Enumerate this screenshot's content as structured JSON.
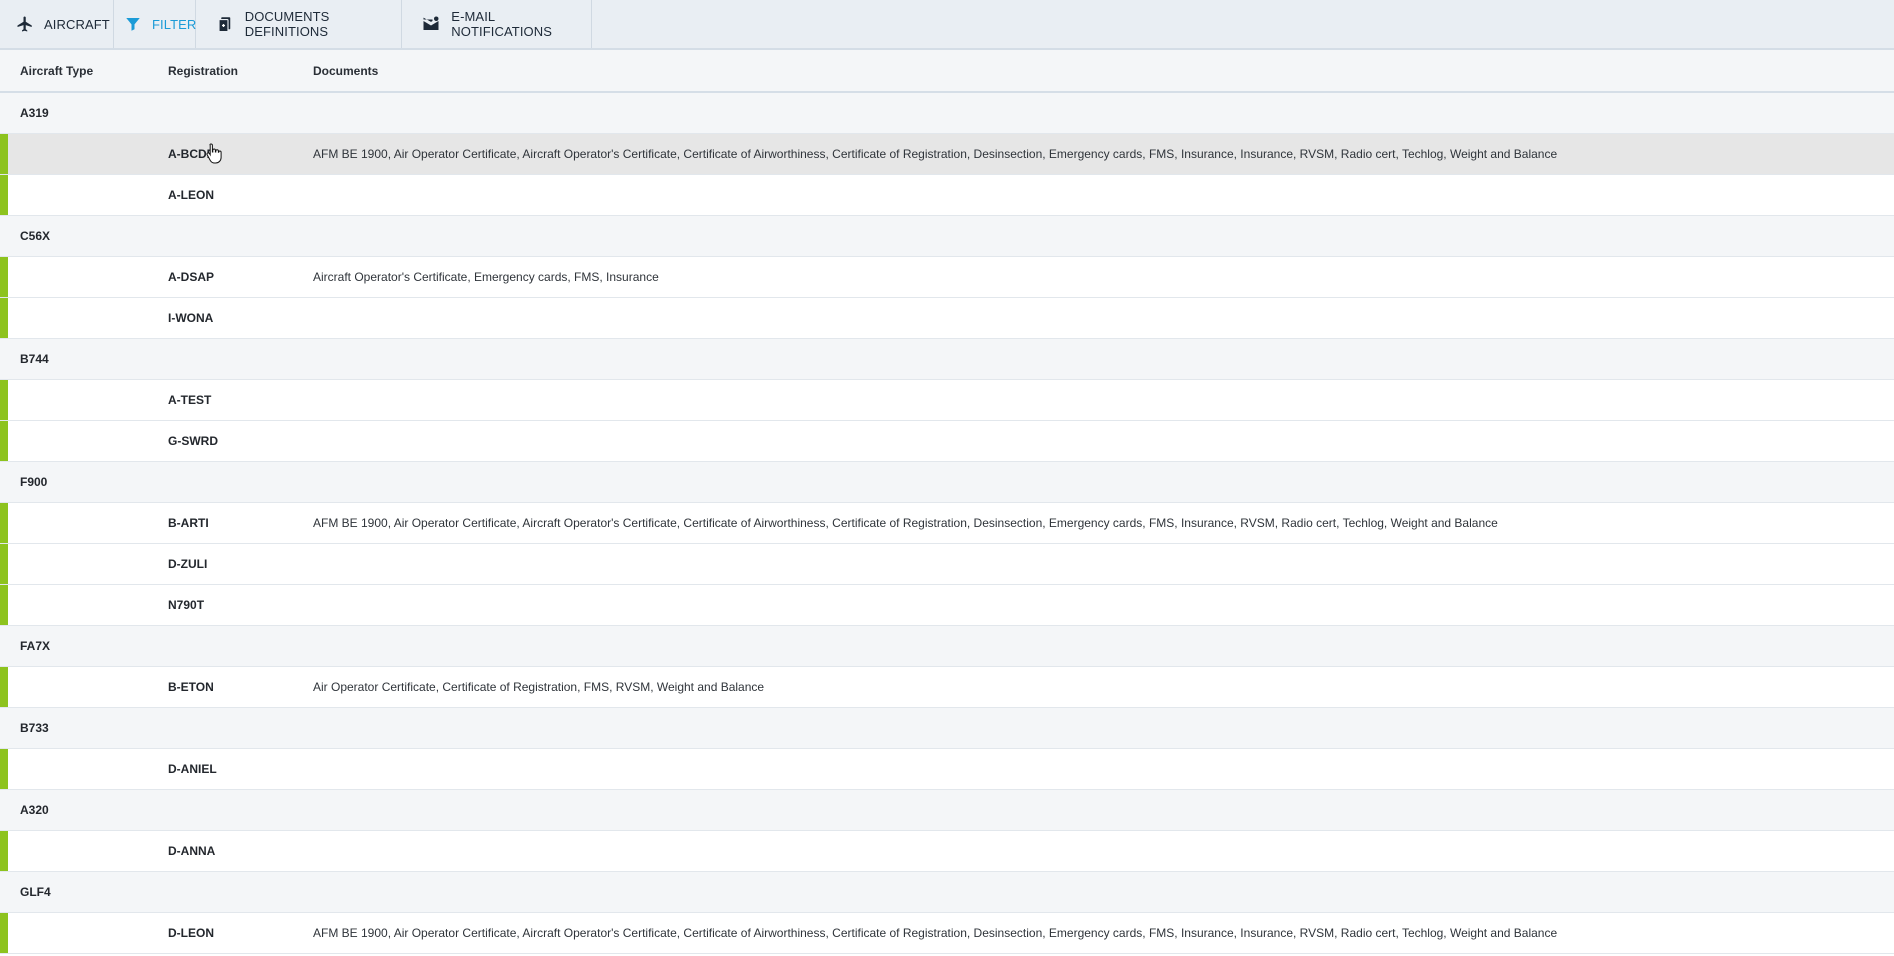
{
  "toolbar": {
    "aircraft_label": "AIRCRAFT",
    "filter_label": "FILTER",
    "documents_definitions_label": "DOCUMENTS DEFINITIONS",
    "email_notifications_label": "E-MAIL NOTIFICATIONS",
    "active_color": "#1b9bd7"
  },
  "table": {
    "headers": {
      "aircraft_type": "Aircraft Type",
      "registration": "Registration",
      "documents": "Documents"
    },
    "status_color": "#8dc31e",
    "groups": [
      {
        "type": "A319",
        "rows": [
          {
            "registration": "A-BCDE",
            "documents": "AFM BE 1900, Air Operator Certificate, Aircraft Operator's Certificate, Certificate of Airworthiness, Certificate of Registration, Desinsection, Emergency cards, FMS, Insurance, Insurance, RVSM, Radio cert, Techlog, Weight and Balance"
          },
          {
            "registration": "A-LEON",
            "documents": ""
          }
        ]
      },
      {
        "type": "C56X",
        "rows": [
          {
            "registration": "A-DSAP",
            "documents": "Aircraft Operator's Certificate, Emergency cards, FMS, Insurance"
          },
          {
            "registration": "I-WONA",
            "documents": ""
          }
        ]
      },
      {
        "type": "B744",
        "rows": [
          {
            "registration": "A-TEST",
            "documents": ""
          },
          {
            "registration": "G-SWRD",
            "documents": ""
          }
        ]
      },
      {
        "type": "F900",
        "rows": [
          {
            "registration": "B-ARTI",
            "documents": "AFM BE 1900, Air Operator Certificate, Aircraft Operator's Certificate, Certificate of Airworthiness, Certificate of Registration, Desinsection, Emergency cards, FMS, Insurance, RVSM, Radio cert, Techlog, Weight and Balance"
          },
          {
            "registration": "D-ZULI",
            "documents": ""
          },
          {
            "registration": "N790T",
            "documents": ""
          }
        ]
      },
      {
        "type": "FA7X",
        "rows": [
          {
            "registration": "B-ETON",
            "documents": "Air Operator Certificate, Certificate of Registration, FMS, RVSM, Weight and Balance"
          }
        ]
      },
      {
        "type": "B733",
        "rows": [
          {
            "registration": "D-ANIEL",
            "documents": ""
          }
        ]
      },
      {
        "type": "A320",
        "rows": [
          {
            "registration": "D-ANNA",
            "documents": ""
          }
        ]
      },
      {
        "type": "GLF4",
        "rows": [
          {
            "registration": "D-LEON",
            "documents": "AFM BE 1900, Air Operator Certificate, Aircraft Operator's Certificate, Certificate of Airworthiness, Certificate of Registration, Desinsection, Emergency cards, FMS, Insurance, Insurance, RVSM, Radio cert, Techlog, Weight and Balance"
          }
        ]
      }
    ]
  }
}
